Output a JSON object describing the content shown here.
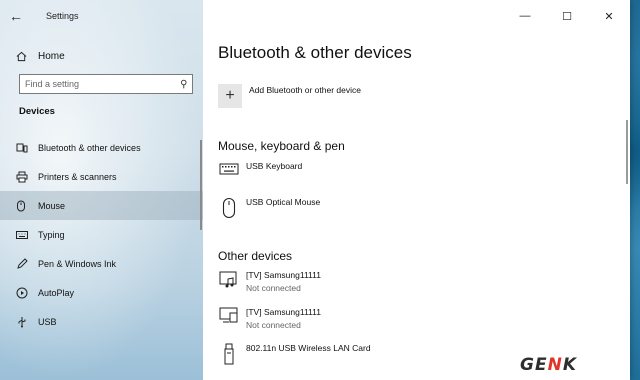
{
  "window": {
    "title": "Settings",
    "controls": {
      "minimize": "—",
      "maximize": "☐",
      "close": "✕"
    }
  },
  "sidebar": {
    "home_label": "Home",
    "search": {
      "placeholder": "Find a setting",
      "value": ""
    },
    "section_label": "Devices",
    "items": [
      {
        "label": "Bluetooth & other devices",
        "icon": "bluetooth-devices-icon",
        "selected": false
      },
      {
        "label": "Printers & scanners",
        "icon": "printer-icon",
        "selected": false
      },
      {
        "label": "Mouse",
        "icon": "mouse-icon",
        "selected": true
      },
      {
        "label": "Typing",
        "icon": "keyboard-icon",
        "selected": false
      },
      {
        "label": "Pen & Windows Ink",
        "icon": "pen-icon",
        "selected": false
      },
      {
        "label": "AutoPlay",
        "icon": "autoplay-icon",
        "selected": false
      },
      {
        "label": "USB",
        "icon": "usb-icon",
        "selected": false
      }
    ]
  },
  "main": {
    "title": "Bluetooth & other devices",
    "add_label": "Add Bluetooth or other device",
    "sections": [
      {
        "title": "Mouse, keyboard & pen",
        "devices": [
          {
            "name": "USB Keyboard",
            "status": "",
            "icon": "keyboard-icon"
          },
          {
            "name": "USB Optical Mouse",
            "status": "",
            "icon": "mouse-icon"
          }
        ]
      },
      {
        "title": "Other devices",
        "devices": [
          {
            "name": "[TV] Samsung11111",
            "status": "Not connected",
            "icon": "tv-media-icon"
          },
          {
            "name": "[TV] Samsung11111",
            "status": "Not connected",
            "icon": "tv-display-icon"
          },
          {
            "name": "802.11n USB Wireless LAN Card",
            "status": "",
            "icon": "usb-adapter-icon"
          }
        ]
      }
    ]
  },
  "watermark": {
    "part1": "GE",
    "part2": "N",
    "part3": "K"
  },
  "colors": {
    "selected_bg": "#b3c3cf",
    "watermark_red": "#e1352a",
    "status_gray": "#666666"
  }
}
